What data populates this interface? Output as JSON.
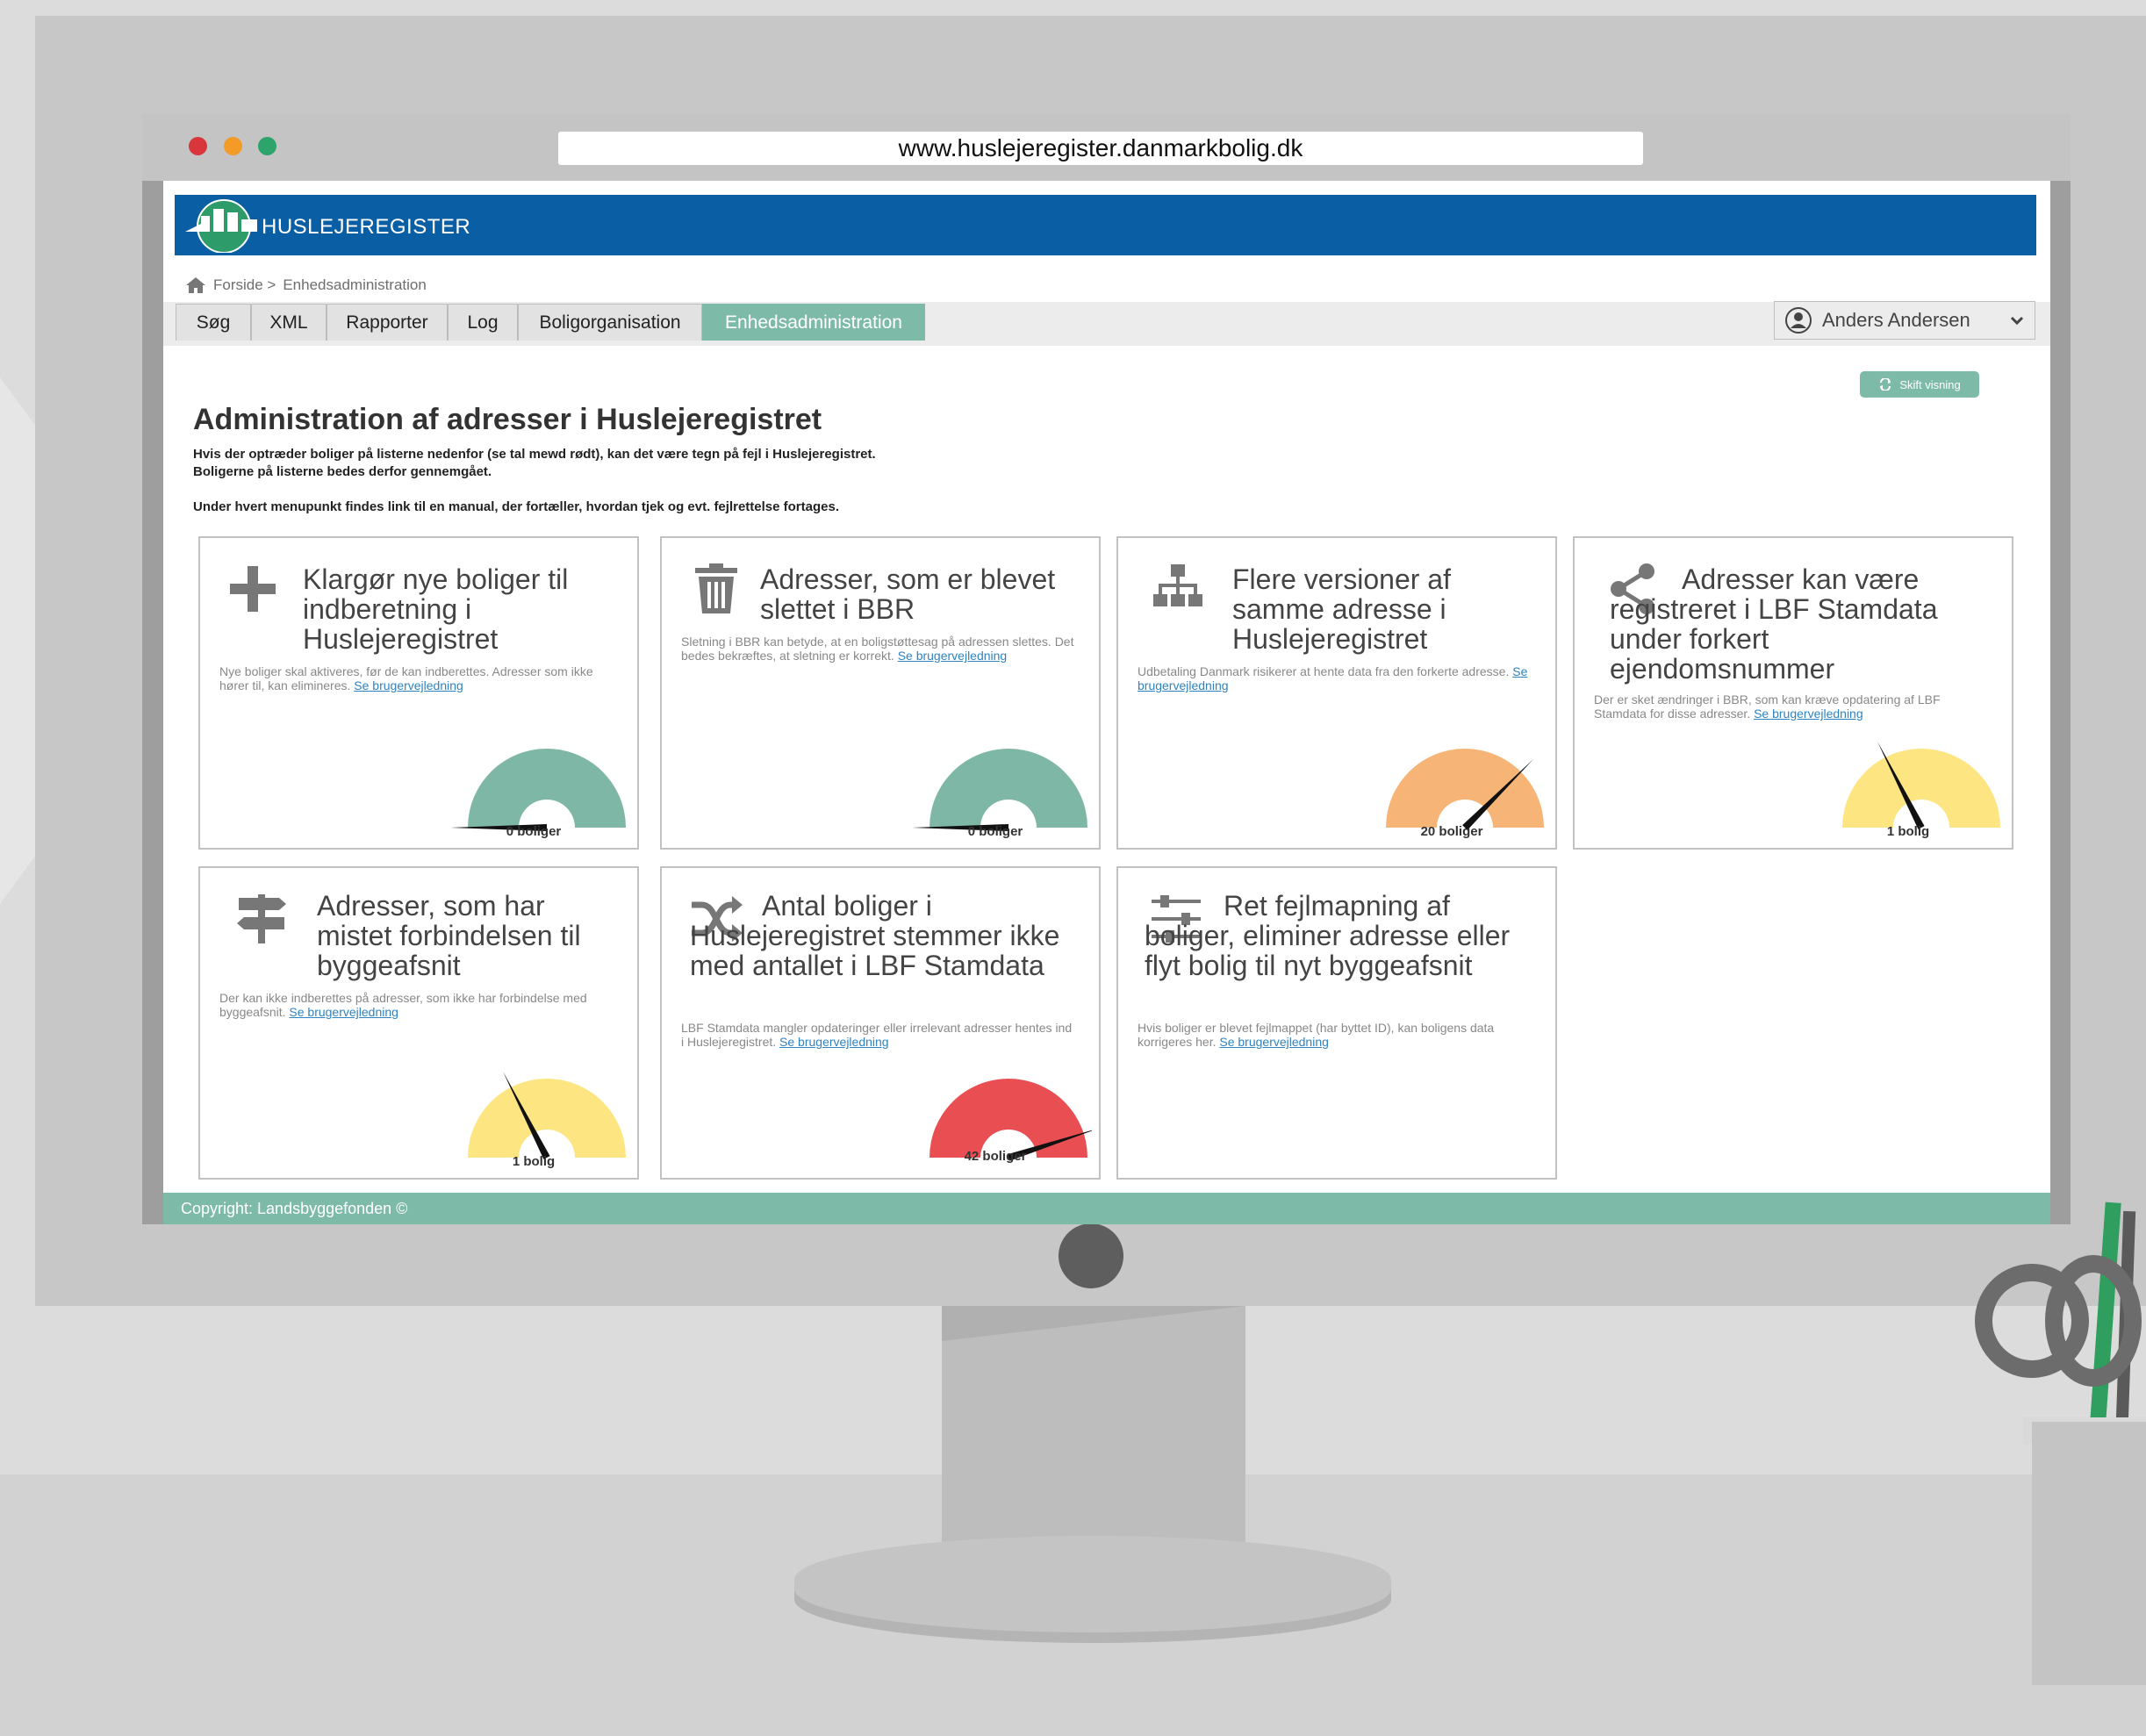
{
  "browser": {
    "url": "www.huslejeregister.danmarkbolig.dk"
  },
  "app": {
    "logo_text": "HUSLEJEREGISTER",
    "brand_color": "#0a5ea3",
    "accent_color": "#7ebaa8"
  },
  "breadcrumb": {
    "home": "Forside >",
    "current": "Enhedsadministration"
  },
  "tabs": [
    "Søg",
    "XML",
    "Rapporter",
    "Log",
    "Boligorganisation",
    "Enhedsadministration"
  ],
  "active_tab": "Enhedsadministration",
  "user": {
    "name": "Anders Andersen"
  },
  "shift_view": "Skift visning",
  "page": {
    "title": "Administration af adresser i Huslejeregistret",
    "intro1": "Hvis der optræder boliger på listerne nedenfor (se tal mewd rødt), kan det være tegn på fejl i Huslejeregistret.",
    "intro2": "Boligerne på listerne bedes derfor gennemgået.",
    "intro3": "Under hvert menupunkt findes link til en manual, der fortæller, hvordan tjek og evt. fejlrettelse fortages."
  },
  "cards": [
    {
      "icon": "plus-icon",
      "title": "Klargør nye boliger til indberetning i Huslejeregistret",
      "desc": "Nye boliger skal aktiveres, før de kan indberettes. Adresser som ikke hører til, kan elimineres.",
      "link": "Se brugervejledning",
      "gauge_label": "0 boliger",
      "gauge_level": 0,
      "gauge_color": "#7fb7a6"
    },
    {
      "icon": "trash-icon",
      "title": "Adresser, som er blevet slettet i BBR",
      "desc": "Sletning i BBR kan betyde, at en boligstøttesag på adressen slettes. Det bedes bekræftes, at sletning er korrekt.",
      "link": "Se brugervejledning",
      "gauge_label": "0 boliger",
      "gauge_level": 0,
      "gauge_color": "#7fb7a6"
    },
    {
      "icon": "sitemap-icon",
      "title": "Flere versioner af samme adresse i Huslejeregistret",
      "desc": "Udbetaling Danmark risikerer at hente data fra den forkerte adresse.",
      "link": "Se brugervejledning",
      "gauge_label": "20 boliger",
      "gauge_level": 0.75,
      "gauge_color": "#f6b476"
    },
    {
      "icon": "share-icon",
      "title": "Adresser kan være registreret i LBF Stamdata under forkert ejendomsnummer",
      "desc": "Der er sket ændringer i BBR, som kan kræve opdatering af LBF Stamdata for disse adresser.",
      "link": "Se brugervejledning",
      "gauge_label": "1 bolig",
      "gauge_level": 0.35,
      "gauge_color": "#fde682"
    },
    {
      "icon": "signpost-icon",
      "title": "Adresser, som har mistet forbindelsen til byggeafsnit",
      "desc": "Der kan ikke indberettes på adresser, som ikke har forbindelse med byggeafsnit.",
      "link": "Se brugervejledning",
      "gauge_label": "1 bolig",
      "gauge_level": 0.35,
      "gauge_color": "#fde682"
    },
    {
      "icon": "shuffle-icon",
      "title": "Antal boliger i Huslejeregistret stemmer ikke med antallet i LBF Stamdata",
      "desc": "LBF Stamdata mangler opdateringer eller irrelevant adresser hentes ind i Huslejeregistret.",
      "link": "Se brugervejledning",
      "gauge_label": "42 boliger",
      "gauge_level": 0.9,
      "gauge_color": "#e94f52"
    },
    {
      "icon": "sliders-icon",
      "title": "Ret fejlmapning af boliger, eliminer adresse eller flyt bolig til nyt byggeafsnit",
      "desc": "Hvis boliger er blevet fejlmappet (har byttet ID), kan boligens data korrigeres her.",
      "link": "Se brugervejledning"
    }
  ],
  "footer": "Copyright: Landsbyggefonden ©"
}
